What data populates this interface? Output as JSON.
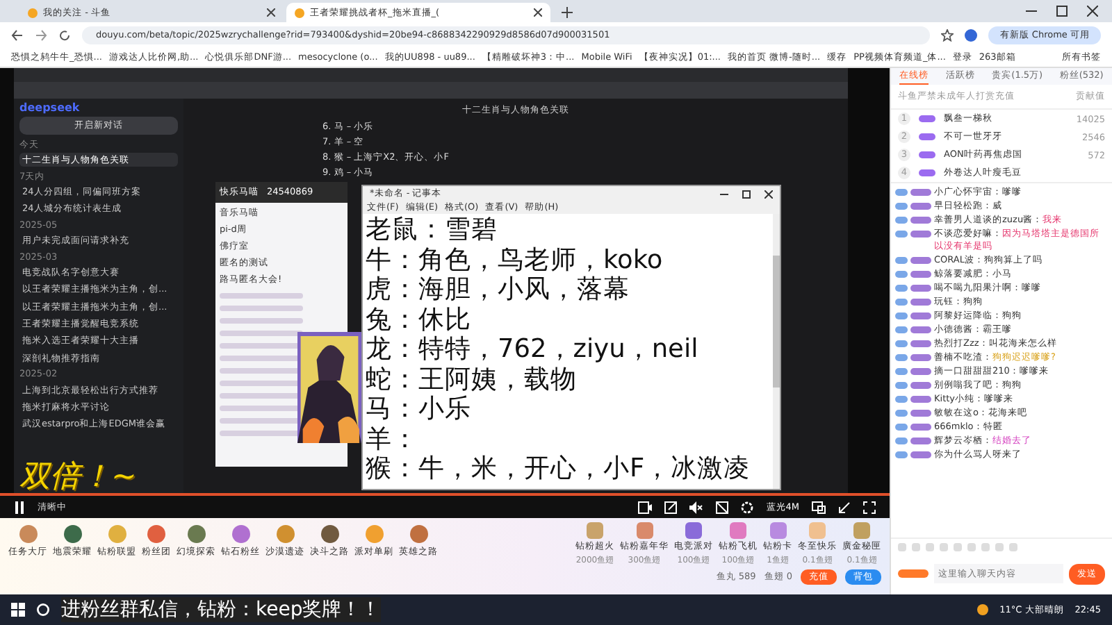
{
  "browser": {
    "tabs": [
      {
        "title": "我的关注 - 斗鱼",
        "selected": false
      },
      {
        "title": "王者荣耀挑战者杯_拖米直播_(",
        "selected": true
      }
    ],
    "address": "douyu.com/beta/topic/2025wzrychallenge?rid=793400&dyshid=20be94-c8688342290929d8586d07d900031501",
    "update_button": "有新版 Chrome 可用",
    "bookmarks": [
      "恐惧之鸫牛牛_恐惧...",
      "游戏达人比价网,助...",
      "心悦俱乐部DNF游...",
      "mesocyclone (o...",
      "我的UU898 - uu89...",
      "【精雕破坏神3：中...",
      "Mobile WiFi",
      "【夜神实况】01:...",
      "我的首页 微博-随时...",
      "缓存",
      "PP视频体育频道_体...",
      "登录",
      "263邮箱"
    ],
    "all_bookmarks": "所有书签"
  },
  "stream": {
    "sidebar": {
      "logo": "deepseek",
      "new_chat": "开启新对话",
      "groups": [
        {
          "label": "今天",
          "items": [
            {
              "title": "十二生肖与人物角色关联",
              "selected": true
            }
          ]
        },
        {
          "label": "7天内",
          "items": [
            {
              "title": "24人分四组，同偏同班方案",
              "selected": false
            },
            {
              "title": "24人城分布统计表生成",
              "selected": false
            }
          ]
        },
        {
          "label": "2025-05",
          "items": [
            {
              "title": "用户未完成面问请求补充",
              "selected": false
            }
          ]
        },
        {
          "label": "2025-03",
          "items": [
            {
              "title": "电竞战队名字创意大赛",
              "selected": false
            },
            {
              "title": "以王者荣耀主播拖米为主角，创...",
              "selected": false
            },
            {
              "title": "以王者荣耀主播拖米为主角，创...",
              "selected": false
            },
            {
              "title": "王者荣耀主播觉醒电竞系统",
              "selected": false
            },
            {
              "title": "拖米入选王者荣耀十大主播",
              "selected": false
            },
            {
              "title": "深剖礼物推荐指南",
              "selected": false
            }
          ]
        },
        {
          "label": "2025-02",
          "items": [
            {
              "title": "上海到北京最轻松出行方式推荐",
              "selected": false
            },
            {
              "title": "拖米打麻将水平讨论",
              "selected": false
            },
            {
              "title": "武汉estarpro和上海EDGM谁会赢",
              "selected": false
            }
          ]
        }
      ]
    },
    "chat": {
      "title": "十二生肖与人物角色关联",
      "lines": [
        "6. 马 – 小乐",
        "7. 羊 – 空",
        "8. 猴 – 上海宁X2、开心、小F",
        "9. 鸡 – 小马"
      ]
    },
    "qq_panel": {
      "group_name": "快乐马喵",
      "group_id": "24540869",
      "items": [
        "音乐马喵",
        "pi-d周",
        "佛疗室",
        "匿名的测试",
        "路马匿名大会!"
      ]
    },
    "notepad": {
      "title": "*未命名 - 记事本",
      "menu": [
        "文件(F)",
        "编辑(E)",
        "格式(O)",
        "查看(V)",
        "帮助(H)"
      ],
      "lines": [
        "老鼠：雪碧",
        "牛：角色，鸟老师，koko",
        "虎：海胆，小风，落幕",
        "兔：休比",
        "龙：特特，762，ziyu，neil",
        "蛇：王阿姨，载物",
        "马：小乐",
        "羊：",
        "猴：牛，米，开心，小F，冰激凌"
      ]
    },
    "overlay_text": "双倍！~",
    "controls": {
      "status": "清晰中",
      "quality": "蓝光4M"
    }
  },
  "gift_bar": {
    "activities": [
      "任务大厅",
      "地震荣耀",
      "钻粉联盟",
      "粉丝团",
      "幻境探索",
      "钻石粉丝",
      "沙漠遗迹",
      "决斗之路",
      "派对单刷",
      "英雄之路"
    ],
    "gifts": [
      {
        "name": "钻粉超火",
        "price": "2000鱼翅"
      },
      {
        "name": "钻粉嘉年华",
        "price": "300鱼翅"
      },
      {
        "name": "电竞派对",
        "price": "100鱼翅"
      },
      {
        "name": "钻粉飞机",
        "price": "100鱼翅"
      },
      {
        "name": "钻粉卡",
        "price": "1鱼翅"
      },
      {
        "name": "冬至快乐",
        "price": "0.1鱼翅"
      },
      {
        "name": "廣金秘匣",
        "price": "0.1鱼翅"
      }
    ],
    "fish_balls": "鱼丸 589",
    "fins": "鱼翅 0",
    "recharge": "充值",
    "backpack": "背包"
  },
  "chat_panel": {
    "tabs": [
      {
        "label": "在线榜",
        "selected": true
      },
      {
        "label": "活跃榜",
        "selected": false
      },
      {
        "label": "贵宾(1.5万)",
        "selected": false
      },
      {
        "label": "粉丝(532)",
        "selected": false
      }
    ],
    "notice": "斗鱼严禁未成年人打赏充值",
    "notice_right": "贡献值",
    "ranks": [
      {
        "rank": "1",
        "name": "飘叁一梯秋",
        "score": "14025"
      },
      {
        "rank": "2",
        "name": "不可一世牙牙",
        "score": "2546"
      },
      {
        "rank": "3",
        "name": "AON叶药再焦虑国",
        "score": "572"
      },
      {
        "rank": "4",
        "name": "外卷达人叶瘦毛豆"
      }
    ],
    "messages": [
      {
        "user": "小广心怀宇宙：",
        "text": "嗲嗲",
        "color": "#333333"
      },
      {
        "user": "早日轻松跑：",
        "text": "威",
        "color": "#333333"
      },
      {
        "user": "幸善男人道谈的zuzu酱：",
        "text": "我来",
        "color": "#e5336b"
      },
      {
        "user": "不谈恋爱好嘛：",
        "text": "因为马塔塔主是德国所以没有羊是吗",
        "color": "#e5336b"
      },
      {
        "user": "CORAL波：",
        "text": "狗狗算上了吗",
        "color": "#333333"
      },
      {
        "user": "鲸落要减肥：",
        "text": "小马",
        "color": "#333333"
      },
      {
        "user": "喝不喝九阳果汁啊：",
        "text": "嗲嗲",
        "color": "#333333"
      },
      {
        "user": "玩钰：",
        "text": "狗狗",
        "color": "#333333"
      },
      {
        "user": "阿黎好运降临：",
        "text": "狗狗",
        "color": "#333333"
      },
      {
        "user": "小德德酱：",
        "text": "霸王嗲",
        "color": "#333333"
      },
      {
        "user": "热烈打Zzz：",
        "text": "叫花海来怎么样",
        "color": "#333333"
      },
      {
        "user": "善楠不吃渣：",
        "text": "狗狗迟迟嗲嗲?",
        "color": "#d9a21b"
      },
      {
        "user": "摘一口甜甜甜210：",
        "text": "嗲嗲来",
        "color": "#333333"
      },
      {
        "user": "别例嗡我了吧：",
        "text": "狗狗",
        "color": "#333333"
      },
      {
        "user": "Kitty小纯：",
        "text": "嗲嗲来",
        "color": "#333333"
      },
      {
        "user": "敏敏在这o：",
        "text": "花海来吧",
        "color": "#333333"
      },
      {
        "user": "666mklo：",
        "text": "特匿",
        "color": "#333333"
      },
      {
        "user": "辉梦云岑栖：",
        "text": "结婚去了",
        "color": "#d43fbf"
      },
      {
        "user": "你为什么骂人呀",
        "text": "来了",
        "color": "#333333"
      }
    ],
    "placeholder": "这里输入聊天内容",
    "send": "发送"
  },
  "taskbar": {
    "caption": "进粉丝群私信，钻粉：keep奖牌！！",
    "weather": "11°C 大部晴朗",
    "time": "22:45"
  }
}
